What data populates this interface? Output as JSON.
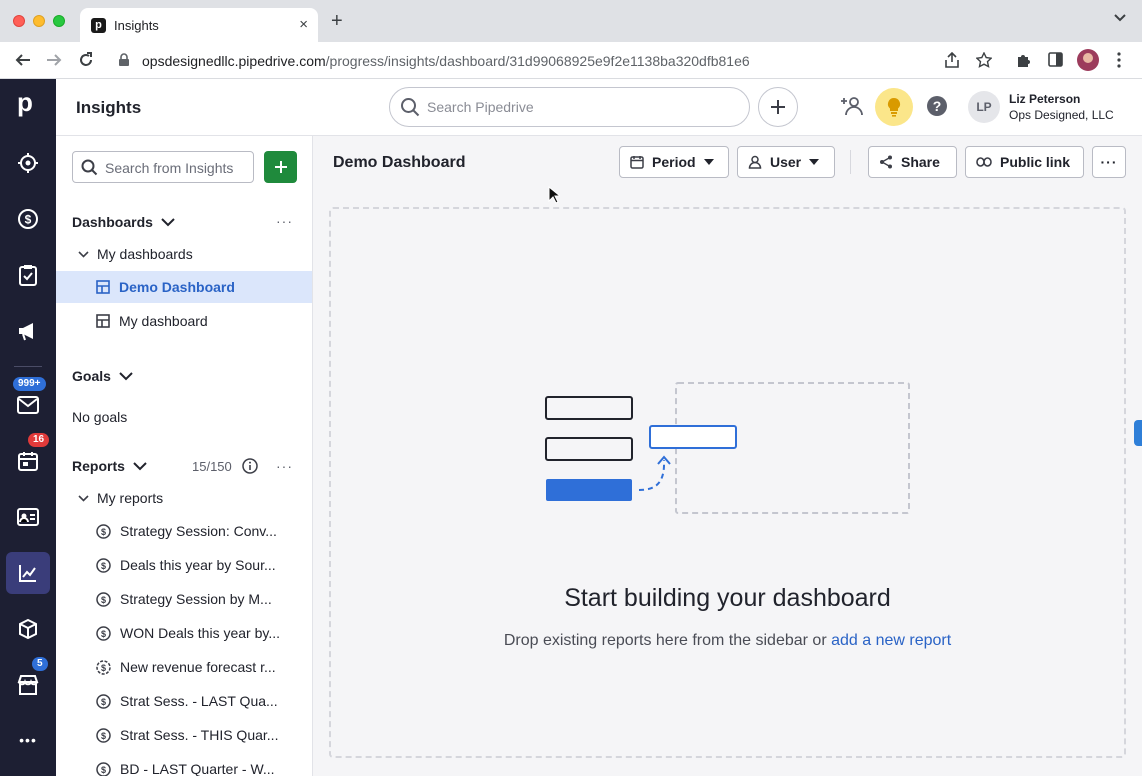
{
  "browser": {
    "tab_title": "Insights",
    "tab_close": "×",
    "new_tab": "+",
    "url_domain": "opsdesignedllc.pipedrive.com",
    "url_path": "/progress/insights/dashboard/31d99068925e9f2e1138ba320dfb81e6"
  },
  "nav": {
    "logo": "p",
    "badges": {
      "mail": "999+",
      "activities": "16",
      "marketplace": "5"
    },
    "more": "•••"
  },
  "header": {
    "title": "Insights",
    "search_placeholder": "Search Pipedrive",
    "avatar_initials": "LP",
    "user_name": "Liz Peterson",
    "user_company": "Ops Designed, LLC",
    "help": "?"
  },
  "sidebar": {
    "search_placeholder": "Search from Insights",
    "dashboards_label": "Dashboards",
    "more_dots": "···",
    "my_dashboards_label": "My dashboards",
    "dashboards": [
      {
        "label": "Demo Dashboard",
        "active": true
      },
      {
        "label": "My dashboard",
        "active": false
      }
    ],
    "goals_label": "Goals",
    "no_goals": "No goals",
    "reports_label": "Reports",
    "reports_count": "15/150",
    "my_reports_label": "My reports",
    "reports": [
      {
        "label": "Strategy Session: Conv...",
        "icon": "dollar-icon"
      },
      {
        "label": "Deals this year by Sour...",
        "icon": "dollar-icon"
      },
      {
        "label": "Strategy Session by M...",
        "icon": "dollar-icon"
      },
      {
        "label": "WON Deals this year by...",
        "icon": "dollar-icon"
      },
      {
        "label": "New revenue forecast r...",
        "icon": "forecast-icon"
      },
      {
        "label": "Strat Sess. - LAST Qua...",
        "icon": "dollar-icon"
      },
      {
        "label": "Strat Sess. - THIS Quar...",
        "icon": "dollar-icon"
      },
      {
        "label": "BD - LAST Quarter - W...",
        "icon": "dollar-icon"
      }
    ]
  },
  "main": {
    "dashboard_title": "Demo Dashboard",
    "period_label": "Period",
    "user_label": "User",
    "share_label": "Share",
    "public_link_label": "Public link",
    "more": "···",
    "empty_title": "Start building your dashboard",
    "empty_sub_prefix": "Drop existing reports here from the sidebar or ",
    "empty_sub_link": "add a new report"
  },
  "colors": {
    "nav_bg": "#1d1f33",
    "accent_blue": "#2a63c6",
    "add_green": "#1f8a3c",
    "badge_blue": "#2f6fd8",
    "badge_red": "#e03a3a"
  }
}
